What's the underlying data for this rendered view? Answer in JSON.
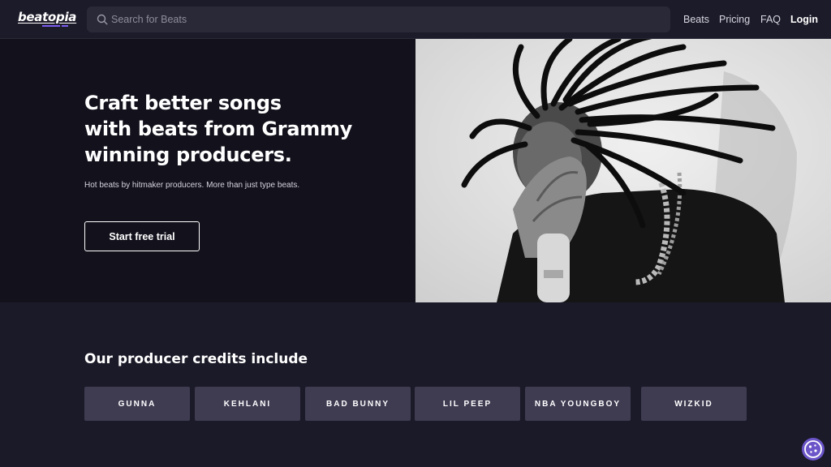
{
  "header": {
    "logo_text": "beatopia",
    "search": {
      "placeholder": "Search for Beats"
    },
    "nav": {
      "beats": "Beats",
      "pricing": "Pricing",
      "faq": "FAQ",
      "login": "Login"
    }
  },
  "hero": {
    "title_lines": [
      "Craft better songs",
      "with beats from Grammy",
      "winning producers."
    ],
    "subtitle": "Hot beats by hitmaker producers. More than just type beats.",
    "cta_label": "Start free trial"
  },
  "credits": {
    "title": "Our producer credits include",
    "artists": [
      "GUNNA",
      "KEHLANI",
      "BAD BUNNY",
      "LIL PEEP",
      "NBA YOUNGBOY",
      "WIZKID"
    ]
  },
  "icons": {
    "search": "search-icon",
    "cookie": "cookie-icon"
  },
  "colors": {
    "background": "#1b1a28",
    "hero_background": "#13121c",
    "tile": "#3f3c52",
    "accent": "#7c5cf0"
  }
}
